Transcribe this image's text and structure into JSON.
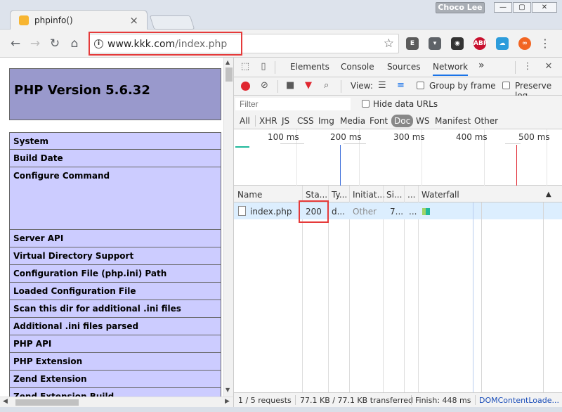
{
  "window": {
    "tab_title": "phpinfo()",
    "user_badge": "Choco Lee",
    "minimize": "—",
    "maximize": "▢",
    "close": "✕"
  },
  "toolbar": {
    "url_host": "www.kkk.com",
    "url_path": "/index.php",
    "extensions": [
      "evernote-icon",
      "pocket-icon",
      "tampermonkey-icon",
      "adblock-plus-icon",
      "cloud-icon",
      "infinity-icon"
    ],
    "abp_text": "ABP"
  },
  "phpinfo": {
    "title": "PHP Version 5.6.32",
    "rows": [
      "System",
      "Build Date",
      "Configure Command",
      "Server API",
      "Virtual Directory Support",
      "Configuration File (php.ini) Path",
      "Loaded Configuration File",
      "Scan this dir for additional .ini files",
      "Additional .ini files parsed",
      "PHP API",
      "PHP Extension",
      "Zend Extension",
      "Zend Extension Build"
    ]
  },
  "devtools": {
    "tabs": [
      "Elements",
      "Console",
      "Sources",
      "Network"
    ],
    "more": "»",
    "network_toolbar": {
      "view_label": "View:",
      "group_by_frame": "Group by frame",
      "preserve_log": "Preserve log"
    },
    "filter": {
      "placeholder": "Filter",
      "hide_data_urls": "Hide data URLs"
    },
    "types": [
      "All",
      "XHR",
      "JS",
      "CSS",
      "Img",
      "Media",
      "Font",
      "Doc",
      "WS",
      "Manifest",
      "Other"
    ],
    "active_type": "Doc",
    "overview_ticks": [
      "100 ms",
      "200 ms",
      "300 ms",
      "400 ms",
      "500 ms"
    ],
    "columns": [
      "Name",
      "Sta...",
      "Ty...",
      "Initiat...",
      "Si...",
      "...",
      "Waterfall"
    ],
    "requests": [
      {
        "name": "index.php",
        "status": "200",
        "type": "d...",
        "initiator": "Other",
        "size": "7...",
        "time": "..."
      }
    ],
    "status_bar": {
      "requests": "1 / 5 requests",
      "transferred": "77.1 KB / 77.1 KB transferred",
      "finish": "Finish: 448 ms",
      "dom": "DOMContentLoade..."
    }
  },
  "colors": {
    "php_header": "#9999cc",
    "php_row": "#ccccff",
    "highlight_red": "#e53a3a",
    "selected_row": "#dceefe"
  }
}
